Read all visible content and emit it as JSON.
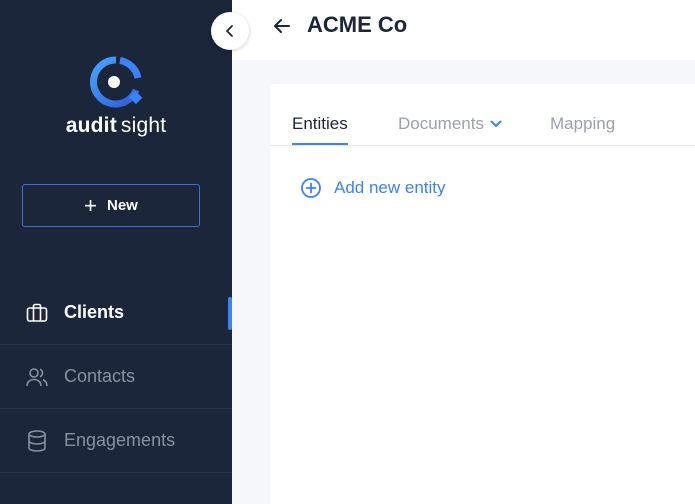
{
  "sidebar": {
    "brand": {
      "part1": "audit",
      "part2": "sight"
    },
    "new_button": {
      "label": "New"
    },
    "nav": [
      {
        "label": "Clients",
        "icon": "briefcase-icon",
        "active": true
      },
      {
        "label": "Contacts",
        "icon": "users-icon",
        "active": false
      },
      {
        "label": "Engagements",
        "icon": "database-icon",
        "active": false
      }
    ]
  },
  "header": {
    "title": "ACME Co"
  },
  "tabs": [
    {
      "label": "Entities",
      "active": true
    },
    {
      "label": "Documents",
      "has_dropdown": true
    },
    {
      "label": "Mapping"
    }
  ],
  "main": {
    "add_entity_label": "Add new entity"
  },
  "colors": {
    "sidebar_bg": "#1b263a",
    "accent": "#3b82f6",
    "text_dark": "#1b263a",
    "text_muted": "#9aa1ad"
  }
}
